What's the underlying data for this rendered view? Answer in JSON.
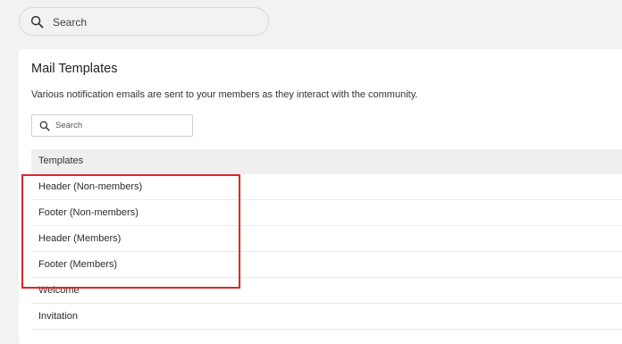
{
  "top_search": {
    "placeholder": "Search",
    "icon": "search-icon"
  },
  "mail_templates": {
    "title": "Mail Templates",
    "description": "Various notification emails are sent to your members as they interact with the community.",
    "search": {
      "placeholder": "Search",
      "icon": "search-icon"
    },
    "table": {
      "header": "Templates",
      "rows": [
        {
          "label": "Header (Non-members)"
        },
        {
          "label": "Footer (Non-members)"
        },
        {
          "label": "Header (Members)"
        },
        {
          "label": "Footer (Members)"
        },
        {
          "label": "Welcome"
        },
        {
          "label": "Invitation"
        }
      ]
    }
  },
  "highlight": {
    "color": "#e0252b"
  }
}
